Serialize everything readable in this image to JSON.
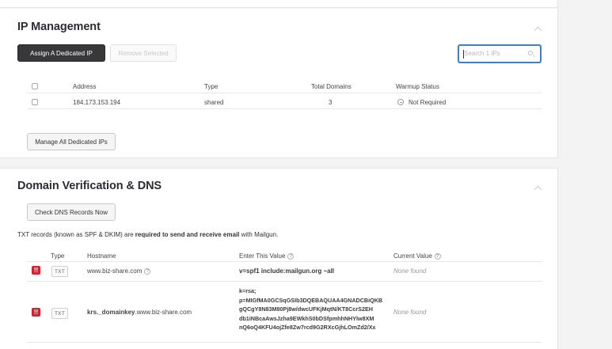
{
  "ip_management": {
    "title": "IP Management",
    "assign_button": "Assign A Dedicated IP",
    "remove_button": "Remove Selected",
    "search_placeholder": "Search 1 IPs",
    "columns": [
      "Address",
      "Type",
      "Total Domains",
      "Warmup Status"
    ],
    "rows": [
      {
        "address": "184.173.153.194",
        "type": "shared",
        "total_domains": "3",
        "warmup_status": "Not Required"
      }
    ],
    "manage_button": "Manage All Dedicated IPs"
  },
  "dns": {
    "title": "Domain Verification & DNS",
    "check_button": "Check DNS Records Now",
    "note_prefix": "TXT records (known as SPF & DKIM) are ",
    "note_bold": "required to send and receive email",
    "note_suffix": " with Mailgun.",
    "columns": [
      "Type",
      "Hostname",
      "Enter This Value",
      "Current Value"
    ],
    "records": [
      {
        "type": "TXT",
        "hostname": "www.biz-share.com",
        "value": "v=spf1 include:mailgun.org ~all",
        "current": "None found"
      },
      {
        "type": "TXT",
        "hostname_bold": "krs._domainkey",
        "hostname_rest": ".www.biz-share.com",
        "value_lines": [
          "k=rsa;",
          "p=MIGfMA0GCSqGSIb3DQEBAQUAA4GNADCBiQKB",
          "gQCgY8N83M80Pj8w/dwcUFKjMqtN/KT8CcrS2EH",
          "db1iNBcaAwsJzha9EWkhS0bDSfpmhhNHYlw8XM",
          "nQ6oQ4KFU4ojZfe8Zw7rcd9G2RXcGjhLOmZd2/Xx"
        ],
        "current": "None found"
      }
    ]
  },
  "colors": {
    "accent": "#3f7fc6",
    "warning": "#d1242f",
    "dark_button": "#38383b"
  }
}
